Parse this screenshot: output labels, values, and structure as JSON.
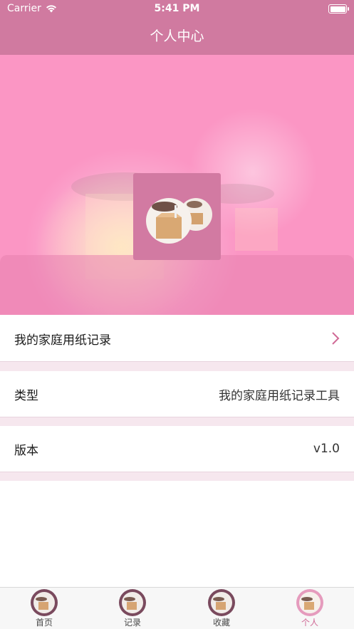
{
  "status_bar": {
    "carrier": "Carrier",
    "time": "5:41 PM"
  },
  "nav": {
    "title": "个人中心"
  },
  "menu": {
    "records_label": "我的家庭用纸记录",
    "type_label": "类型",
    "type_value": "我的家庭用纸记录工具",
    "version_label": "版本",
    "version_value": "v1.0"
  },
  "tabs": [
    {
      "label": "首页",
      "active": false
    },
    {
      "label": "记录",
      "active": false
    },
    {
      "label": "收藏",
      "active": false
    },
    {
      "label": "个人",
      "active": true
    }
  ],
  "colors": {
    "accent": "#d07aa0",
    "hero_bg": "#fb96c4",
    "active_tab": "#d06a96"
  }
}
